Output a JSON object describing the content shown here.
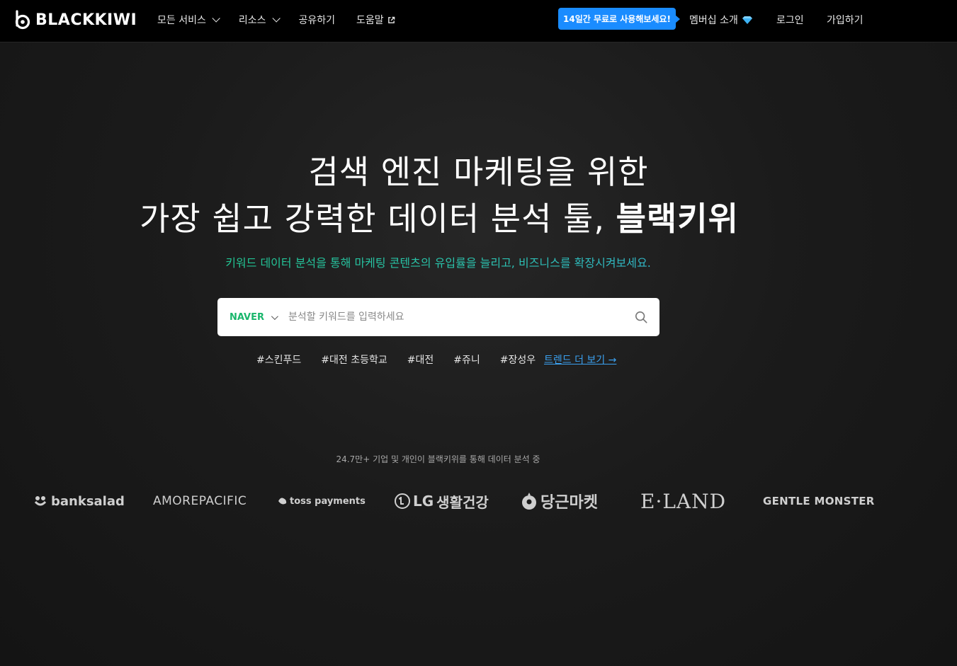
{
  "header": {
    "logo_text": "BLACKKIWI",
    "nav": [
      {
        "label": "모든 서비스"
      },
      {
        "label": "리소스"
      },
      {
        "label": "공유하기"
      },
      {
        "label": "도움말"
      }
    ],
    "promo_label": "14일간 무료로 사용해보세요!",
    "membership_label": "멤버십 소개",
    "login_label": "로그인",
    "signup_label": "가입하기"
  },
  "hero": {
    "line1": "검색 엔진 마케팅을 위한",
    "line2_prefix": "가장 쉽고 강력한 데이터 분석 툴, ",
    "line2_bold": "블랙키위",
    "subtitle": "키워드 데이터 분석을 통해 마케팅 콘텐츠의 유입률을 늘리고, 비즈니스를 확장시켜보세요."
  },
  "search": {
    "engine": "NAVER",
    "placeholder": "분석할 키워드를 입력하세요",
    "value": ""
  },
  "tags": [
    "#스킨푸드",
    "#대전 초등학교",
    "#대전",
    "#쥬니",
    "#장성우"
  ],
  "trend_link": "트렌드 더 보기 →",
  "stats_text": "24.7만+ 기업 및 개인이 블랙키위를 통해 데이터 분석 중",
  "brands": {
    "banksalad": "banksalad",
    "amore": "AMOREPACIFIC",
    "toss": "toss payments",
    "lg_mark": "LG",
    "lg": "생활건강",
    "daangn": "당근마켓",
    "eland": "E·LAND",
    "gentle": "GENTLE MONSTER"
  },
  "colors": {
    "accent_blue": "#1a8cff",
    "naver_green": "#19b66c",
    "link_blue": "#3ba1f0",
    "background": "#1b1b1b"
  }
}
